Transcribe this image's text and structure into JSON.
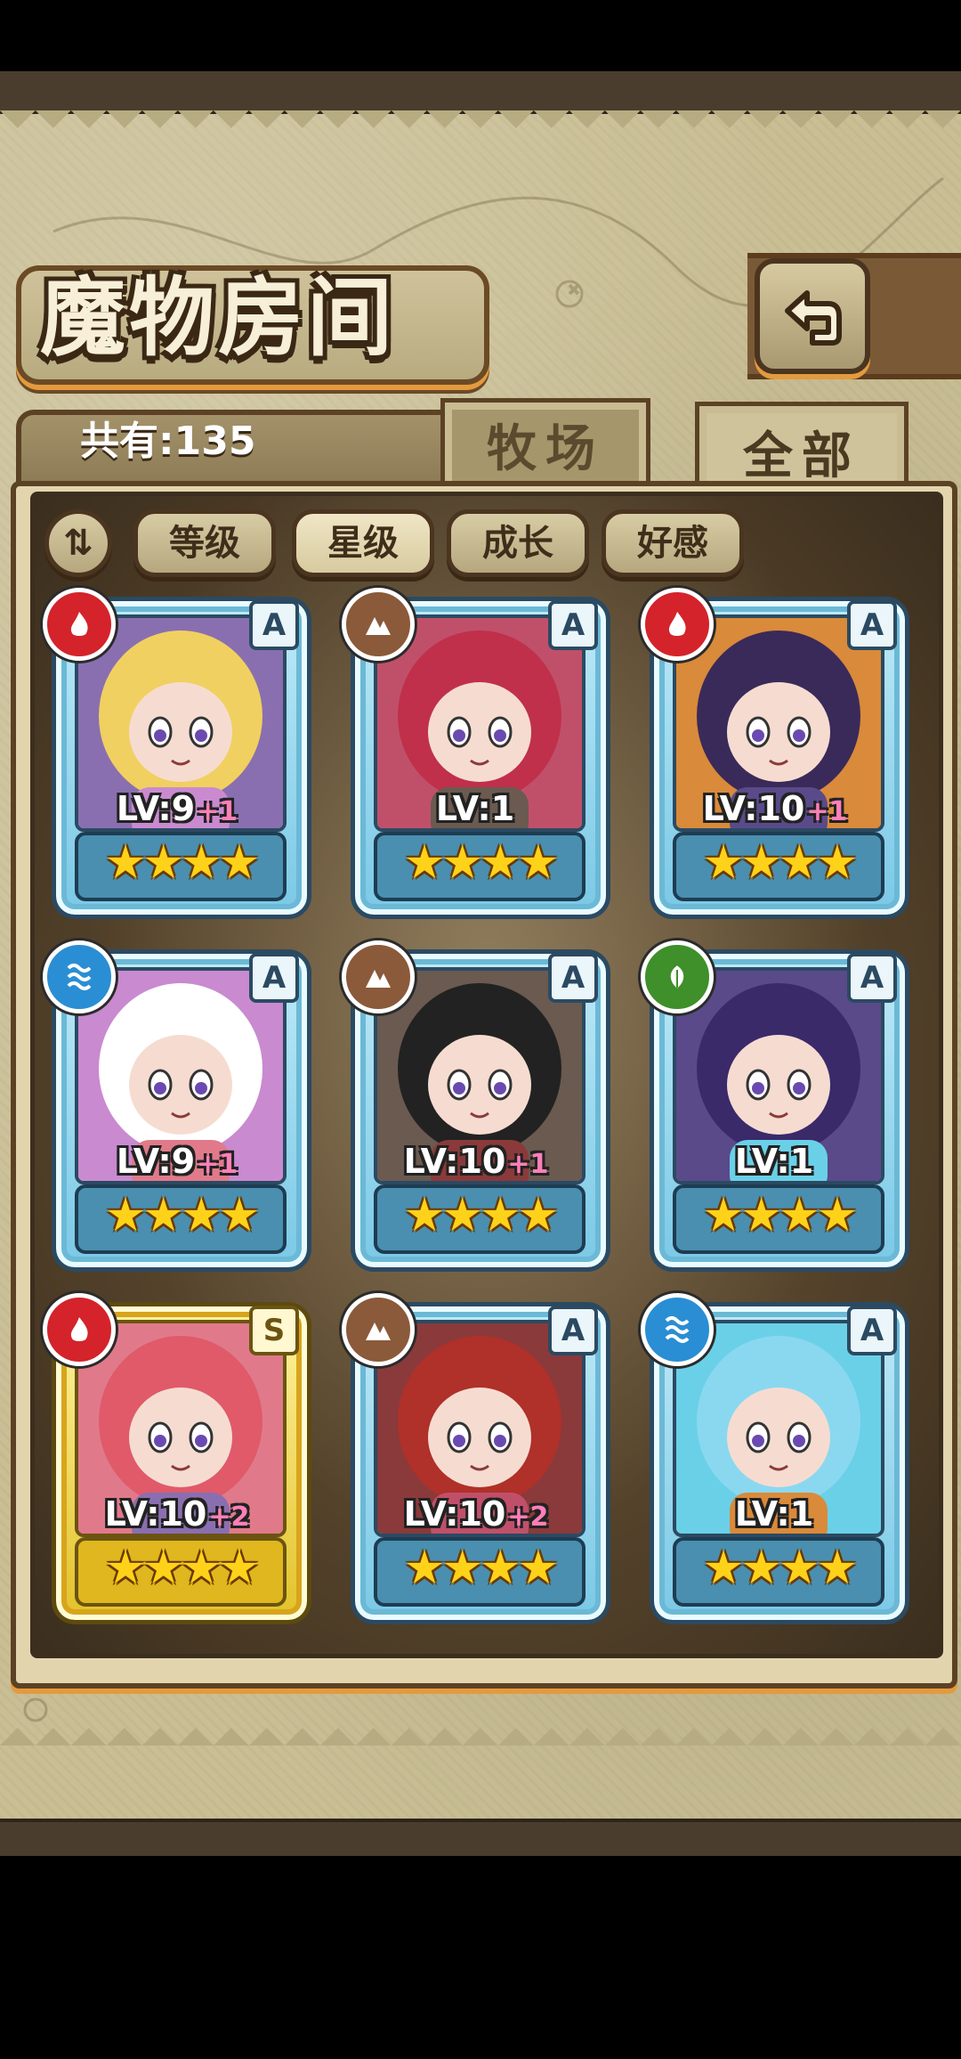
{
  "header": {
    "title": "魔物房间",
    "back_icon": "back-arrow-icon"
  },
  "tabs": {
    "count_text": "共有:135",
    "pasture_label": "牧场",
    "all_label": "全部"
  },
  "sort": {
    "toggle_label": "⇅",
    "buttons": [
      "等级",
      "星级",
      "成长",
      "好感"
    ],
    "active": "星级"
  },
  "colors": {
    "fire": "#d4232a",
    "earth": "#8a5a3a",
    "water": "#2a8ed4",
    "wood": "#3f8f2a",
    "frame_blue": "#7ac8e6",
    "frame_gold": "#e2c22a"
  },
  "cards": [
    {
      "element": "fire",
      "rank": "A",
      "level": "LV:9",
      "plus": "+1",
      "stars": "★★★★"
    },
    {
      "element": "earth",
      "rank": "A",
      "level": "LV:1",
      "plus": "",
      "stars": "★★★★"
    },
    {
      "element": "fire",
      "rank": "A",
      "level": "LV:10",
      "plus": "+1",
      "stars": "★★★★"
    },
    {
      "element": "water",
      "rank": "A",
      "level": "LV:9",
      "plus": "+1",
      "stars": "★★★★"
    },
    {
      "element": "earth",
      "rank": "A",
      "level": "LV:10",
      "plus": "+1",
      "stars": "★★★★"
    },
    {
      "element": "wood",
      "rank": "A",
      "level": "LV:1",
      "plus": "",
      "stars": "★★★★"
    },
    {
      "element": "fire",
      "rank": "S",
      "level": "LV:10",
      "plus": "+2",
      "stars": "★★★★"
    },
    {
      "element": "earth",
      "rank": "A",
      "level": "LV:10",
      "plus": "+2",
      "stars": "★★★★"
    },
    {
      "element": "water",
      "rank": "A",
      "level": "LV:1",
      "plus": "",
      "stars": "★★★★"
    }
  ]
}
